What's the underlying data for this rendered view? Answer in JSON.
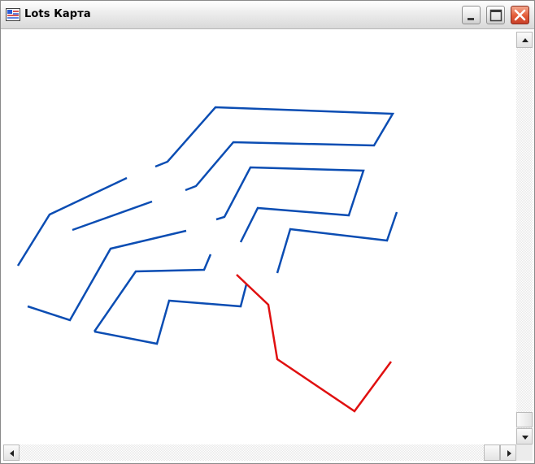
{
  "window": {
    "title": "Lots Карта",
    "icon": "app-map-icon",
    "controls": [
      "minimize-icon",
      "maximize-icon",
      "close-icon"
    ]
  },
  "map": {
    "route_colors": {
      "lots": "#0b4db3",
      "path": "#e01010"
    },
    "lot_polylines": 14,
    "path_polylines": 1
  },
  "scrollbars": {
    "vertical": {
      "up": "arrow-up-icon",
      "down": "arrow-down-icon"
    },
    "horizontal": {
      "left": "arrow-left-icon",
      "right": "arrow-right-icon"
    }
  }
}
